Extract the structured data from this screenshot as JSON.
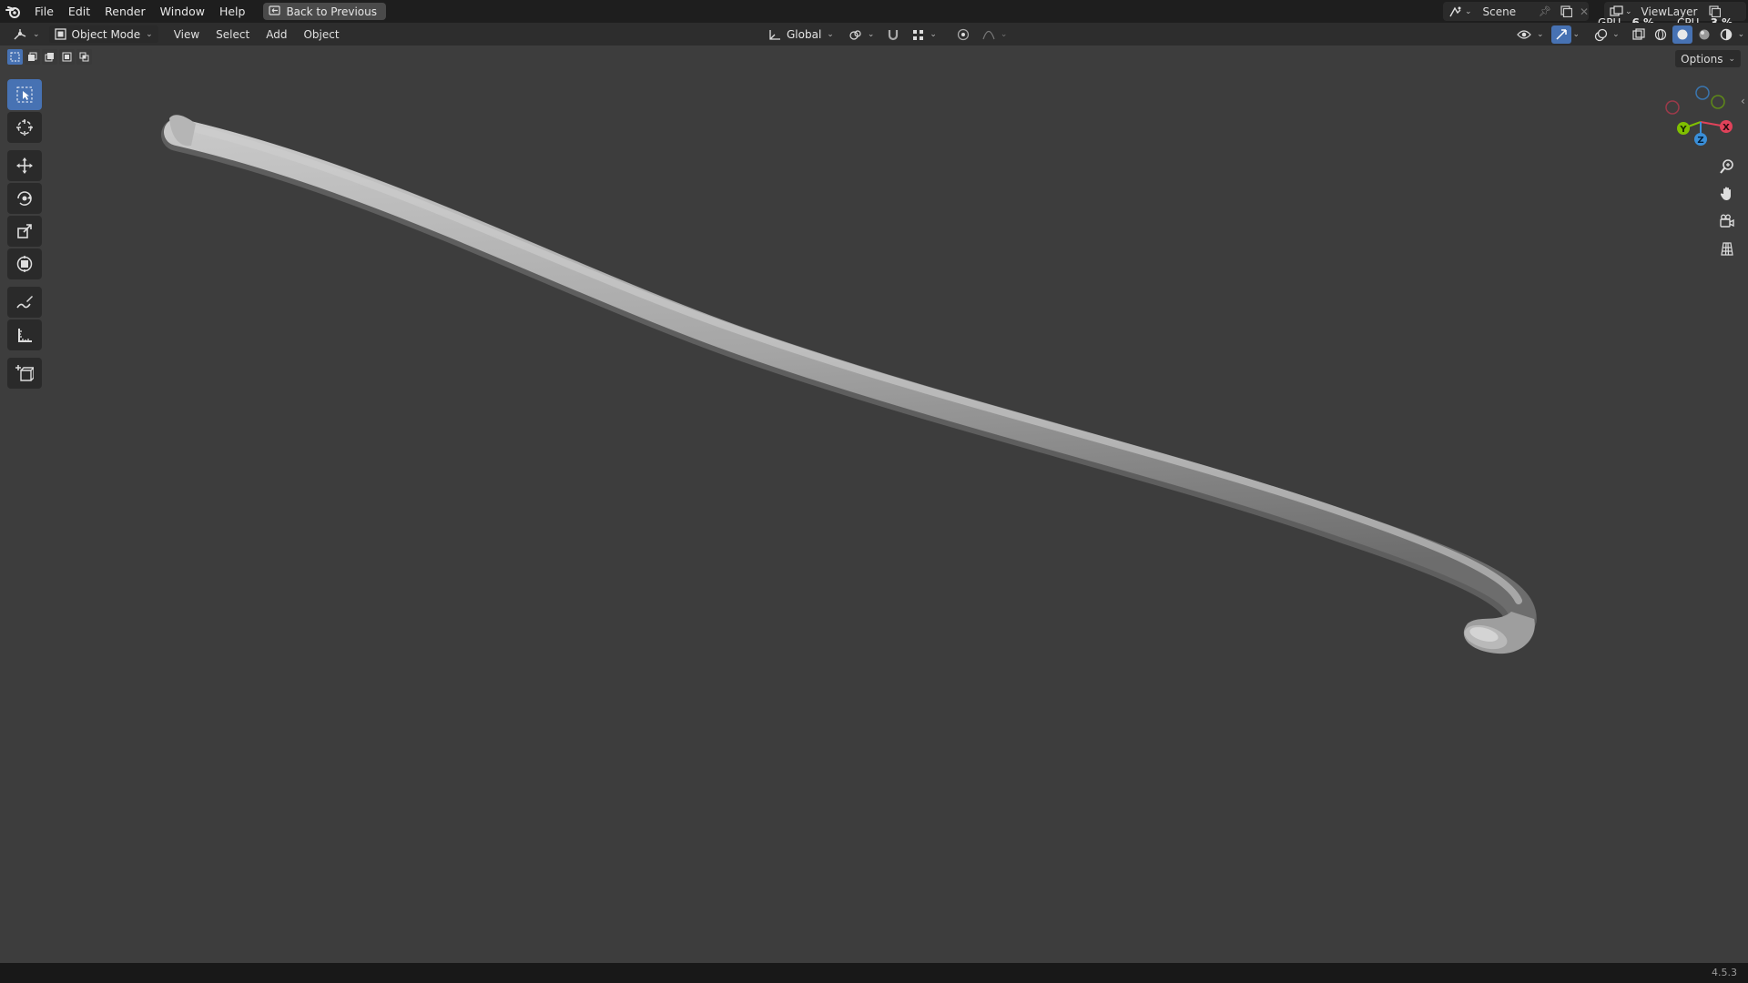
{
  "app": {
    "menu": [
      "File",
      "Edit",
      "Render",
      "Window",
      "Help"
    ],
    "back_button": "Back to Previous",
    "scene": "Scene",
    "view_layer": "ViewLayer",
    "gpu_label": "GPU",
    "gpu_value": "6 %",
    "cpu_label": "CPU",
    "cpu_value": "3 %"
  },
  "header": {
    "mode": "Object Mode",
    "menus": [
      "View",
      "Select",
      "Add",
      "Object"
    ],
    "transform_orientation": "Global"
  },
  "options_label": "Options",
  "toolbar": {
    "tools": [
      "select-box-icon",
      "cursor-icon",
      "move-icon",
      "rotate-icon",
      "scale-icon",
      "transform-icon",
      "annotate-icon",
      "measure-icon",
      "add-cube-icon"
    ],
    "active": "select-box-icon"
  },
  "gizmo": {
    "x": "X",
    "y": "Y",
    "z": "Z"
  },
  "navigation": [
    "zoom-icon",
    "pan-hand-icon",
    "camera-icon",
    "ortho-grid-icon"
  ],
  "colors": {
    "accent": "#4772b3",
    "x_axis": "#e0425a",
    "y_axis": "#80c000",
    "z_axis": "#3a8fd9",
    "viewport": "#3d3d3d"
  },
  "version": "4.5.3"
}
